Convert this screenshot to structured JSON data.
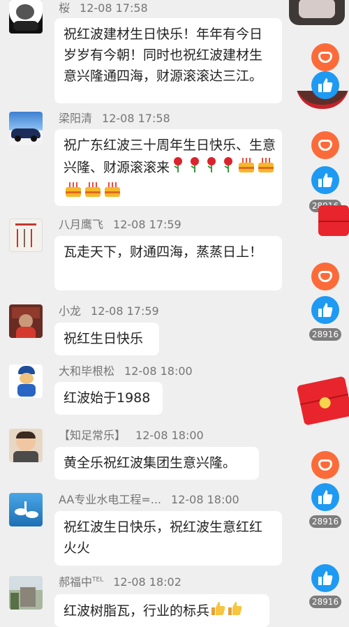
{
  "messages": [
    {
      "name": "桜",
      "time": "12-08 17:58",
      "text": "祝红波建材生日快乐！年年有今日岁岁有今朝！同时也祝红波建材生意兴隆通四海，财源滚滚达三江。"
    },
    {
      "name": "梁阳清",
      "time": "12-08 17:58",
      "text": "祝广东红波三十周年生日快乐、生意兴隆、财源滚滚来"
    },
    {
      "name": "八月鹰飞",
      "time": "12-08 17:59",
      "text": "瓦走天下，财通四海，蒸蒸日上！"
    },
    {
      "name": "小龙",
      "time": "12-08 17:59",
      "text": "祝红生日快乐"
    },
    {
      "name": "大和毕根松",
      "time": "12-08 18:00",
      "text": "红波始于1988"
    },
    {
      "name": "【知足常乐】",
      "time": "12-08 18:00",
      "text": "黄全乐祝红波集团生意兴隆。"
    },
    {
      "name": "AA专业水电工程=...",
      "time": "12-08 18:00",
      "text": "祝红波生日快乐，祝红波生意红红火火"
    },
    {
      "name": "郝福中",
      "name_suffix": "TEL",
      "time": "12-08 18:02",
      "text": "红波树脂瓦，行业的标兵"
    }
  ],
  "counts": [
    "28916",
    "28916",
    "28916",
    "28916"
  ],
  "icons": [
    "invite-icon",
    "thumbs-up-icon",
    "red-packet-icon",
    "rose-emoji",
    "cake-emoji",
    "thumbs-up-emoji"
  ],
  "colors": {
    "invite": "#fb6b3a",
    "like": "#1e9af3",
    "packet": "#e8252c",
    "bg": "#efefef"
  }
}
